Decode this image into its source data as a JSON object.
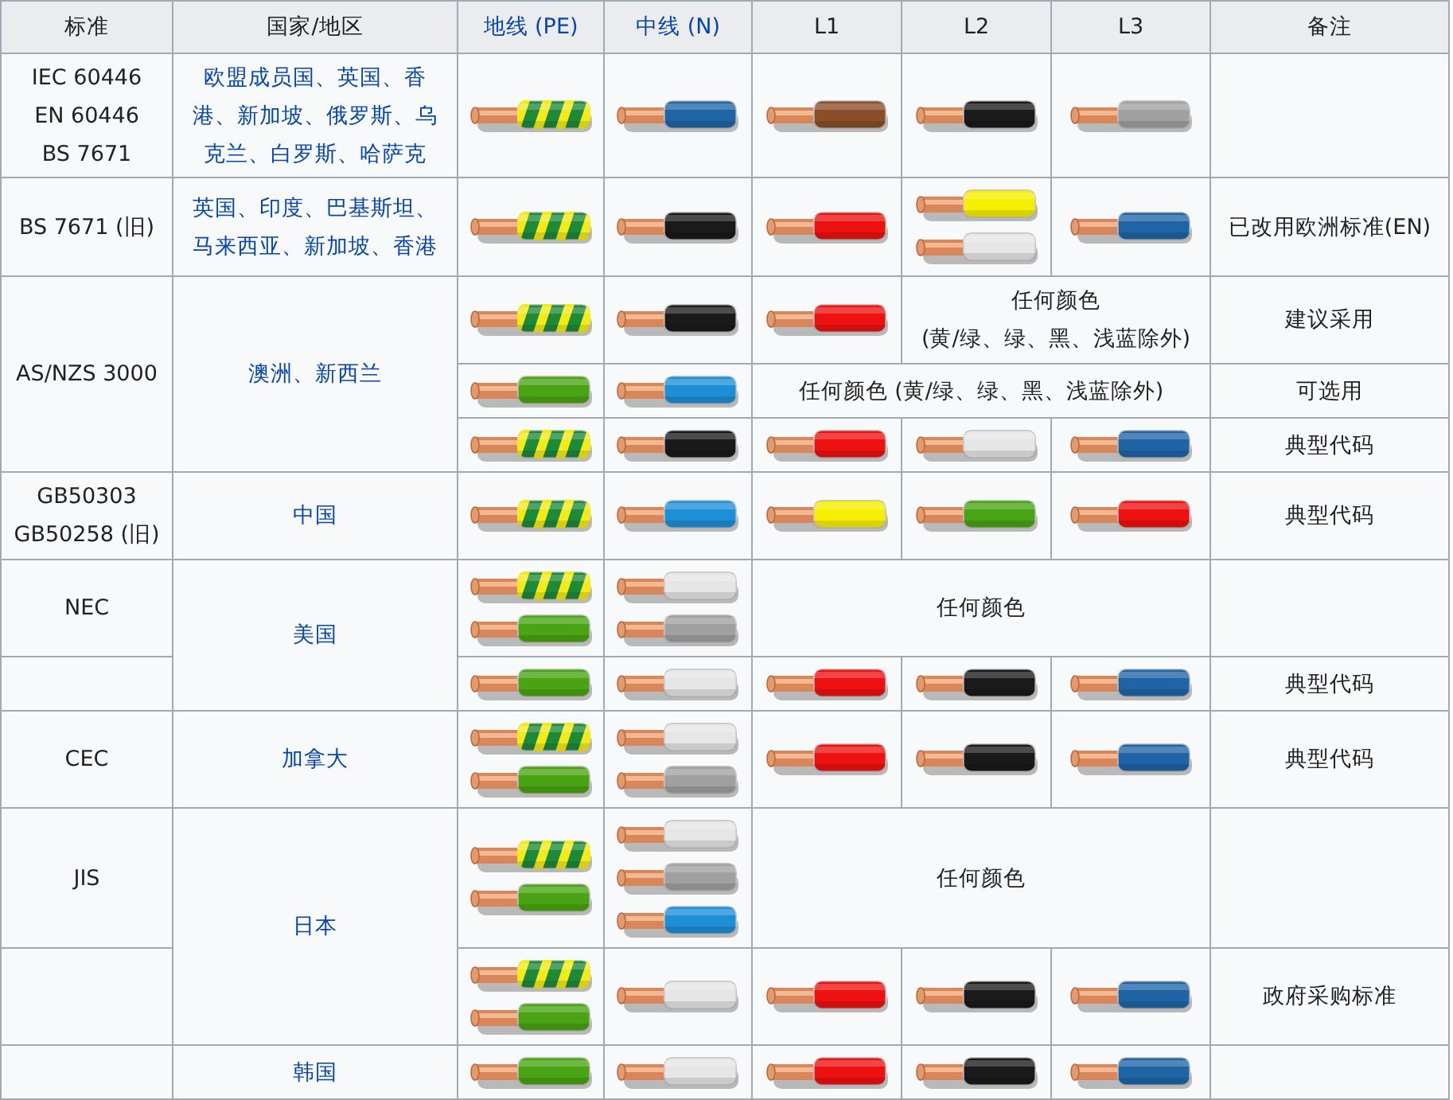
{
  "header": [
    {
      "kind": "text",
      "text": "标准"
    },
    {
      "kind": "text",
      "text": "国家/地区"
    },
    {
      "kind": "link",
      "text": "地线 (PE)"
    },
    {
      "kind": "link",
      "text": "中线 (N)"
    },
    {
      "kind": "text",
      "text": "L1"
    },
    {
      "kind": "text",
      "text": "L2"
    },
    {
      "kind": "text",
      "text": "L3"
    },
    {
      "kind": "text",
      "text": "备注"
    }
  ],
  "rows": [
    {
      "cells": [
        {
          "kind": "text",
          "text": "IEC 60446\nEN 60446\nBS 7671"
        },
        {
          "kind": "link",
          "text": "欧盟成员国、英国、香港、新加坡、俄罗斯、乌克兰、白罗斯、哈萨克"
        },
        {
          "kind": "wires",
          "wires": [
            {
              "kind": "striped",
              "color": "#1d8a3a"
            }
          ]
        },
        {
          "kind": "wires",
          "wires": [
            {
              "kind": "plain",
              "color": "#1f65a6"
            }
          ]
        },
        {
          "kind": "wires",
          "wires": [
            {
              "kind": "plain",
              "color": "#8a4e2a"
            }
          ]
        },
        {
          "kind": "wires",
          "wires": [
            {
              "kind": "plain",
              "color": "#1a1a1a"
            }
          ]
        },
        {
          "kind": "wires",
          "wires": [
            {
              "kind": "plain",
              "color": "#a0a0a0"
            }
          ]
        },
        {
          "kind": "empty"
        }
      ]
    },
    {
      "cells": [
        {
          "kind": "text",
          "text": "BS 7671 (旧)"
        },
        {
          "kind": "link",
          "text": "英国、印度、巴基斯坦、马来西亚、新加坡、香港"
        },
        {
          "kind": "wires",
          "wires": [
            {
              "kind": "striped",
              "color": "#1d8a3a"
            }
          ]
        },
        {
          "kind": "wires",
          "wires": [
            {
              "kind": "plain",
              "color": "#1a1a1a"
            }
          ]
        },
        {
          "kind": "wires",
          "wires": [
            {
              "kind": "plain",
              "color": "#ee1111"
            }
          ]
        },
        {
          "kind": "wires",
          "wires": [
            {
              "kind": "plain",
              "color": "#f5ef00"
            },
            {
              "kind": "plain",
              "color": "#e6e6e6"
            }
          ]
        },
        {
          "kind": "wires",
          "wires": [
            {
              "kind": "plain",
              "color": "#1f65a6"
            }
          ]
        },
        {
          "kind": "text",
          "text": "已改用欧洲标准(EN)"
        }
      ]
    },
    {
      "cells": [
        {
          "kind": "text",
          "text": "AS/NZS 3000"
        },
        {
          "kind": "link",
          "text": "澳洲、新西兰"
        },
        {
          "kind": "wires",
          "wires": [
            {
              "kind": "striped",
              "color": "#1d8a3a"
            }
          ]
        },
        {
          "kind": "wires",
          "wires": [
            {
              "kind": "plain",
              "color": "#1a1a1a"
            }
          ]
        },
        {
          "kind": "wires",
          "wires": [
            {
              "kind": "plain",
              "color": "#ee1111"
            }
          ]
        },
        {
          "kind": "text",
          "text": "任何颜色\n(黄/绿、绿、黑、浅蓝除外)"
        },
        {
          "kind": "join-left"
        },
        {
          "kind": "text",
          "text": "建议采用"
        }
      ]
    },
    {
      "cells": [
        {
          "kind": "join-up"
        },
        {
          "kind": "join-up"
        },
        {
          "kind": "wires",
          "wires": [
            {
              "kind": "plain",
              "color": "#4aa312"
            }
          ]
        },
        {
          "kind": "wires",
          "wires": [
            {
              "kind": "plain",
              "color": "#1d8fd6"
            }
          ]
        },
        {
          "kind": "text",
          "text": "任何颜色 (黄/绿、绿、黑、浅蓝除外)"
        },
        {
          "kind": "join-left"
        },
        {
          "kind": "join-left"
        },
        {
          "kind": "text",
          "text": "可选用"
        }
      ]
    },
    {
      "cells": [
        {
          "kind": "join-up"
        },
        {
          "kind": "join-up"
        },
        {
          "kind": "wires",
          "wires": [
            {
              "kind": "striped",
              "color": "#1d8a3a"
            }
          ]
        },
        {
          "kind": "wires",
          "wires": [
            {
              "kind": "plain",
              "color": "#1a1a1a"
            }
          ]
        },
        {
          "kind": "wires",
          "wires": [
            {
              "kind": "plain",
              "color": "#ee1111"
            }
          ]
        },
        {
          "kind": "wires",
          "wires": [
            {
              "kind": "plain",
              "color": "#e6e6e6"
            }
          ]
        },
        {
          "kind": "wires",
          "wires": [
            {
              "kind": "plain",
              "color": "#1f65a6"
            }
          ]
        },
        {
          "kind": "text",
          "text": "典型代码"
        }
      ]
    },
    {
      "cells": [
        {
          "kind": "text",
          "text": "GB50303\nGB50258 (旧)"
        },
        {
          "kind": "link",
          "text": "中国"
        },
        {
          "kind": "wires",
          "wires": [
            {
              "kind": "striped",
              "color": "#1d8a3a"
            }
          ]
        },
        {
          "kind": "wires",
          "wires": [
            {
              "kind": "plain",
              "color": "#1d8fd6"
            }
          ]
        },
        {
          "kind": "wires",
          "wires": [
            {
              "kind": "plain",
              "color": "#f5ef00"
            }
          ]
        },
        {
          "kind": "wires",
          "wires": [
            {
              "kind": "plain",
              "color": "#4aa312"
            }
          ]
        },
        {
          "kind": "wires",
          "wires": [
            {
              "kind": "plain",
              "color": "#ee1111"
            }
          ]
        },
        {
          "kind": "text",
          "text": "典型代码"
        }
      ]
    },
    {
      "cells": [
        {
          "kind": "text",
          "text": "NEC"
        },
        {
          "kind": "link",
          "text": "美国"
        },
        {
          "kind": "wires",
          "wires": [
            {
              "kind": "striped",
              "color": "#1d8a3a"
            },
            {
              "kind": "plain",
              "color": "#4aa312"
            }
          ]
        },
        {
          "kind": "wires",
          "wires": [
            {
              "kind": "plain",
              "color": "#e6e6e6"
            },
            {
              "kind": "plain",
              "color": "#a0a0a0"
            }
          ]
        },
        {
          "kind": "text",
          "text": "任何颜色"
        },
        {
          "kind": "join-left"
        },
        {
          "kind": "join-left"
        },
        {
          "kind": "empty"
        }
      ]
    },
    {
      "cells": [
        {
          "kind": "empty"
        },
        {
          "kind": "join-up"
        },
        {
          "kind": "wires",
          "wires": [
            {
              "kind": "plain",
              "color": "#4aa312"
            }
          ]
        },
        {
          "kind": "wires",
          "wires": [
            {
              "kind": "plain",
              "color": "#e6e6e6"
            }
          ]
        },
        {
          "kind": "wires",
          "wires": [
            {
              "kind": "plain",
              "color": "#ee1111"
            }
          ]
        },
        {
          "kind": "wires",
          "wires": [
            {
              "kind": "plain",
              "color": "#1a1a1a"
            }
          ]
        },
        {
          "kind": "wires",
          "wires": [
            {
              "kind": "plain",
              "color": "#1f65a6"
            }
          ]
        },
        {
          "kind": "text",
          "text": "典型代码"
        }
      ]
    },
    {
      "cells": [
        {
          "kind": "text",
          "text": "CEC"
        },
        {
          "kind": "link",
          "text": "加拿大"
        },
        {
          "kind": "wires",
          "wires": [
            {
              "kind": "striped",
              "color": "#1d8a3a"
            },
            {
              "kind": "plain",
              "color": "#4aa312"
            }
          ]
        },
        {
          "kind": "wires",
          "wires": [
            {
              "kind": "plain",
              "color": "#e6e6e6"
            },
            {
              "kind": "plain",
              "color": "#a0a0a0"
            }
          ]
        },
        {
          "kind": "wires",
          "wires": [
            {
              "kind": "plain",
              "color": "#ee1111"
            }
          ]
        },
        {
          "kind": "wires",
          "wires": [
            {
              "kind": "plain",
              "color": "#1a1a1a"
            }
          ]
        },
        {
          "kind": "wires",
          "wires": [
            {
              "kind": "plain",
              "color": "#1f65a6"
            }
          ]
        },
        {
          "kind": "text",
          "text": "典型代码"
        }
      ]
    },
    {
      "cells": [
        {
          "kind": "text",
          "text": "JIS"
        },
        {
          "kind": "link",
          "text": "日本"
        },
        {
          "kind": "wires",
          "wires": [
            {
              "kind": "striped",
              "color": "#1d8a3a"
            },
            {
              "kind": "plain",
              "color": "#4aa312"
            }
          ]
        },
        {
          "kind": "wires",
          "wires": [
            {
              "kind": "plain",
              "color": "#e6e6e6"
            },
            {
              "kind": "plain",
              "color": "#a0a0a0"
            },
            {
              "kind": "plain",
              "color": "#1d8fd6"
            }
          ]
        },
        {
          "kind": "text",
          "text": "任何颜色"
        },
        {
          "kind": "join-left"
        },
        {
          "kind": "join-left"
        },
        {
          "kind": "empty"
        }
      ]
    },
    {
      "cells": [
        {
          "kind": "empty"
        },
        {
          "kind": "join-up"
        },
        {
          "kind": "wires",
          "wires": [
            {
              "kind": "striped",
              "color": "#1d8a3a"
            },
            {
              "kind": "plain",
              "color": "#4aa312"
            }
          ]
        },
        {
          "kind": "wires",
          "wires": [
            {
              "kind": "plain",
              "color": "#e6e6e6"
            }
          ]
        },
        {
          "kind": "wires",
          "wires": [
            {
              "kind": "plain",
              "color": "#ee1111"
            }
          ]
        },
        {
          "kind": "wires",
          "wires": [
            {
              "kind": "plain",
              "color": "#1a1a1a"
            }
          ]
        },
        {
          "kind": "wires",
          "wires": [
            {
              "kind": "plain",
              "color": "#1f65a6"
            }
          ]
        },
        {
          "kind": "text",
          "text": "政府采购标准"
        }
      ]
    },
    {
      "cells": [
        {
          "kind": "empty"
        },
        {
          "kind": "link",
          "text": "韩国"
        },
        {
          "kind": "wires",
          "wires": [
            {
              "kind": "plain",
              "color": "#4aa312"
            }
          ]
        },
        {
          "kind": "wires",
          "wires": [
            {
              "kind": "plain",
              "color": "#e6e6e6"
            }
          ]
        },
        {
          "kind": "wires",
          "wires": [
            {
              "kind": "plain",
              "color": "#ee1111"
            }
          ]
        },
        {
          "kind": "wires",
          "wires": [
            {
              "kind": "plain",
              "color": "#1a1a1a"
            }
          ]
        },
        {
          "kind": "wires",
          "wires": [
            {
              "kind": "plain",
              "color": "#1f65a6"
            }
          ]
        },
        {
          "kind": "empty"
        }
      ]
    }
  ]
}
